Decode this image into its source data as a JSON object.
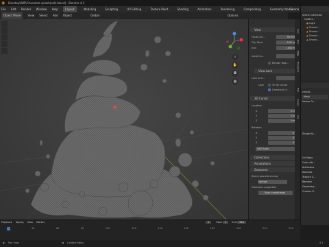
{
  "window": {
    "title": "Desktop\\WIP\\Chocolate splash(old).blend] - Blender 4.1"
  },
  "menu": {
    "items": [
      "File",
      "Edit",
      "Render",
      "Window",
      "Help"
    ],
    "tabs": [
      "Layout",
      "Modeling",
      "Sculpting",
      "UV Editing",
      "Texture Paint",
      "Shading",
      "Animation",
      "Rendering",
      "Compositing",
      "Geometry Nodes",
      "Scripting"
    ],
    "active_tab": "Layout",
    "scene": "Scene"
  },
  "header": {
    "mode": "Object Mode",
    "items": [
      "View",
      "Select",
      "Add",
      "Object"
    ],
    "global": "Global",
    "options": "Options"
  },
  "npanel": {
    "view_header": "View",
    "focal_length_label": "Focal Len...",
    "focal_length_value": "50 mm",
    "clip_start_label": "Clip Start",
    "clip_start_value": "0.01 m",
    "end_label": "End",
    "end_value": "1000 m",
    "local_camera_label": "Local Ca...",
    "render_region": "Render Regi...",
    "view_lock_header": "View Lock",
    "lock_to_object_label": "Lock to O...",
    "lock_label": "Lock",
    "to_3d_cursor": "To 3D Cursor",
    "camera_to_view": "Camera to V...",
    "cursor_header": "3D Cursor",
    "location_label": "Location",
    "x_label": "X",
    "x_value": "0 m",
    "y_label": "Y",
    "y_value": "0 m",
    "z_label": "Z",
    "z_value": "0 m",
    "rotation_label": "Rotation",
    "rx_value": "0°",
    "ry_value": "0°",
    "rz_value": "0°",
    "euler": "XYZ Euler",
    "collections": "Collections",
    "annotations": "Annotations",
    "geoscene": "Geoscene",
    "scene_georef": "Scene georeferencing",
    "not_set": "Not set",
    "geoscene_props": "Geoscene properties",
    "scan_coords": "Scan coordinates",
    "tabs": [
      "Item",
      "Tool",
      "View",
      "Blenderkit",
      "Edit",
      "Create",
      "GIS"
    ]
  },
  "outliner": {
    "items": [
      "Scene Collection",
      "Collect...",
      "Light",
      "Chocol...",
      "Chocol...",
      "Chocol...",
      "Chocol..."
    ]
  },
  "props": {
    "object": "chocol...",
    "mesh": "Mesh",
    "sections": [
      "Vertex Gr...",
      "Shape Ke...",
      "UV Maps",
      "Color Att...",
      "Attributes",
      "Normals",
      "Texture S...",
      "Remesh",
      "Geometry...",
      "Custom P..."
    ]
  },
  "timeline": {
    "playback": "Playback",
    "keying": "Keying",
    "view": "View",
    "marker": "Marker",
    "start_label": "Start",
    "start_value": "1",
    "end_label": "End",
    "end_value": "250",
    "current_frame": "1",
    "ticks": [
      "20",
      "40",
      "60",
      "80",
      "100",
      "120",
      "140",
      "160",
      "180",
      "200",
      "220",
      "240"
    ]
  },
  "status": {
    "pan_view": "Pan View",
    "context_menu": "Context Menu",
    "version": "4.1"
  },
  "colors": {
    "accent": "#4772b3",
    "active_orange": "#e2812e",
    "mesh": "#6a6a6a",
    "viewport_bg": "#3d3d3d"
  }
}
